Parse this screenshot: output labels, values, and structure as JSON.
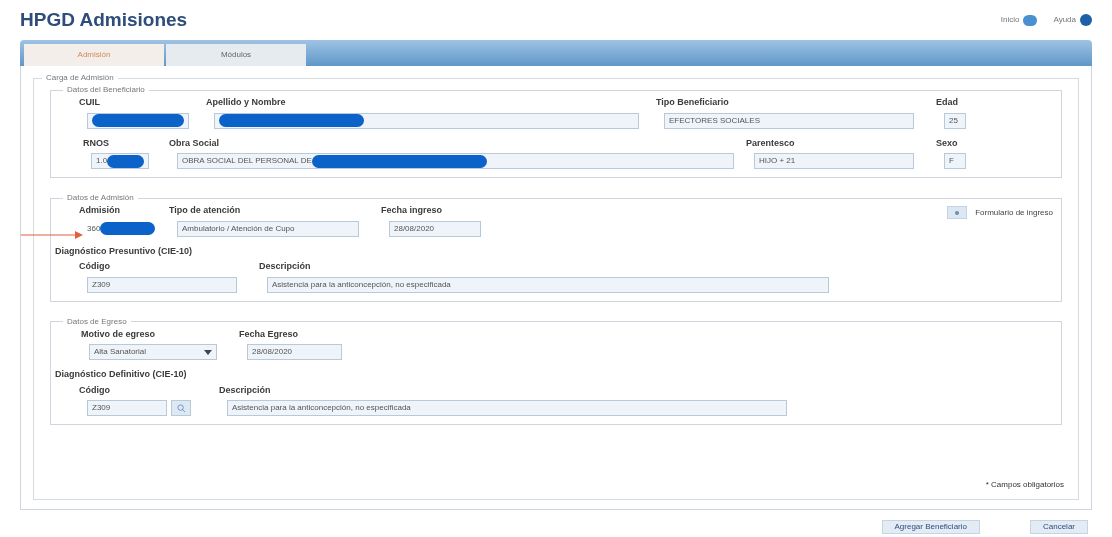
{
  "header": {
    "title": "HPGD Admisiones",
    "links": [
      {
        "label": "Inicio",
        "kind": "home"
      },
      {
        "label": "Ayuda",
        "kind": "help"
      }
    ]
  },
  "tabs": [
    {
      "label": "Admisión",
      "selected": true
    },
    {
      "label": "Módulos",
      "selected": false
    }
  ],
  "form": {
    "legend": "Carga de Admisión",
    "sections": [
      {
        "legend": "Datos del Beneficiario",
        "pointer": false,
        "rows": [
          {
            "fields": [
              {
                "label": "CUIL",
                "redacted": true
              },
              {
                "label": "Apellido y Nombre",
                "redacted": true
              },
              {
                "label": "Tipo Beneficiario",
                "value": "EFECTORES SOCIALES",
                "redacted": false
              },
              {
                "label": "Edad",
                "value": "25",
                "redacted": false
              }
            ]
          },
          {
            "fields": [
              {
                "label": "RNOS",
                "value": "1.0",
                "redacted": true
              },
              {
                "label": "Obra Social",
                "value": "OBRA SOCIAL DEL PERSONAL DE",
                "redacted": true
              },
              {
                "label": "Parentesco",
                "value": "HIJO + 21",
                "redacted": false
              },
              {
                "label": "Sexo",
                "value": "F",
                "redacted": false
              }
            ]
          }
        ]
      },
      {
        "legend": "Datos de Admisión",
        "pointer": true,
        "action": {
          "label": "Formulario de ingreso"
        },
        "rows": [
          {
            "fields": [
              {
                "label": "Admisión",
                "value": "360",
                "redacted": true,
                "kind": "plain"
              },
              {
                "label": "Tipo de atención",
                "value": "Ambulatorio / Atención de Cupo",
                "redacted": false
              },
              {
                "label": "Fecha ingreso",
                "value": "28/08/2020",
                "redacted": false
              }
            ]
          },
          {
            "heading": "Diagnóstico Presuntivo (CIE-10)",
            "fields": [
              {
                "label": "Código",
                "value": "Z309",
                "redacted": false
              },
              {
                "label": "Descripción",
                "value": "Asistencia para la anticoncepción, no especificada",
                "redacted": false
              }
            ]
          }
        ]
      },
      {
        "legend": "Datos de Egreso",
        "pointer": false,
        "rows": [
          {
            "fields": [
              {
                "label": "Motivo de egreso",
                "value": "Alta Sanatorial",
                "redacted": false,
                "kind": "select"
              },
              {
                "label": "Fecha Egreso",
                "value": "28/08/2020",
                "redacted": false
              }
            ]
          },
          {
            "heading": "Diagnóstico Definitivo (CIE-10)",
            "fields": [
              {
                "label": "Código",
                "value": "Z309",
                "redacted": false,
                "kind": "lookup"
              },
              {
                "label": "Descripción",
                "value": "Asistencia para la anticoncepción, no especificada",
                "redacted": false
              }
            ]
          }
        ]
      }
    ],
    "note": "* Campos obligatorios"
  },
  "buttons": [
    "Agregar Beneficiario",
    "Cancelar"
  ]
}
